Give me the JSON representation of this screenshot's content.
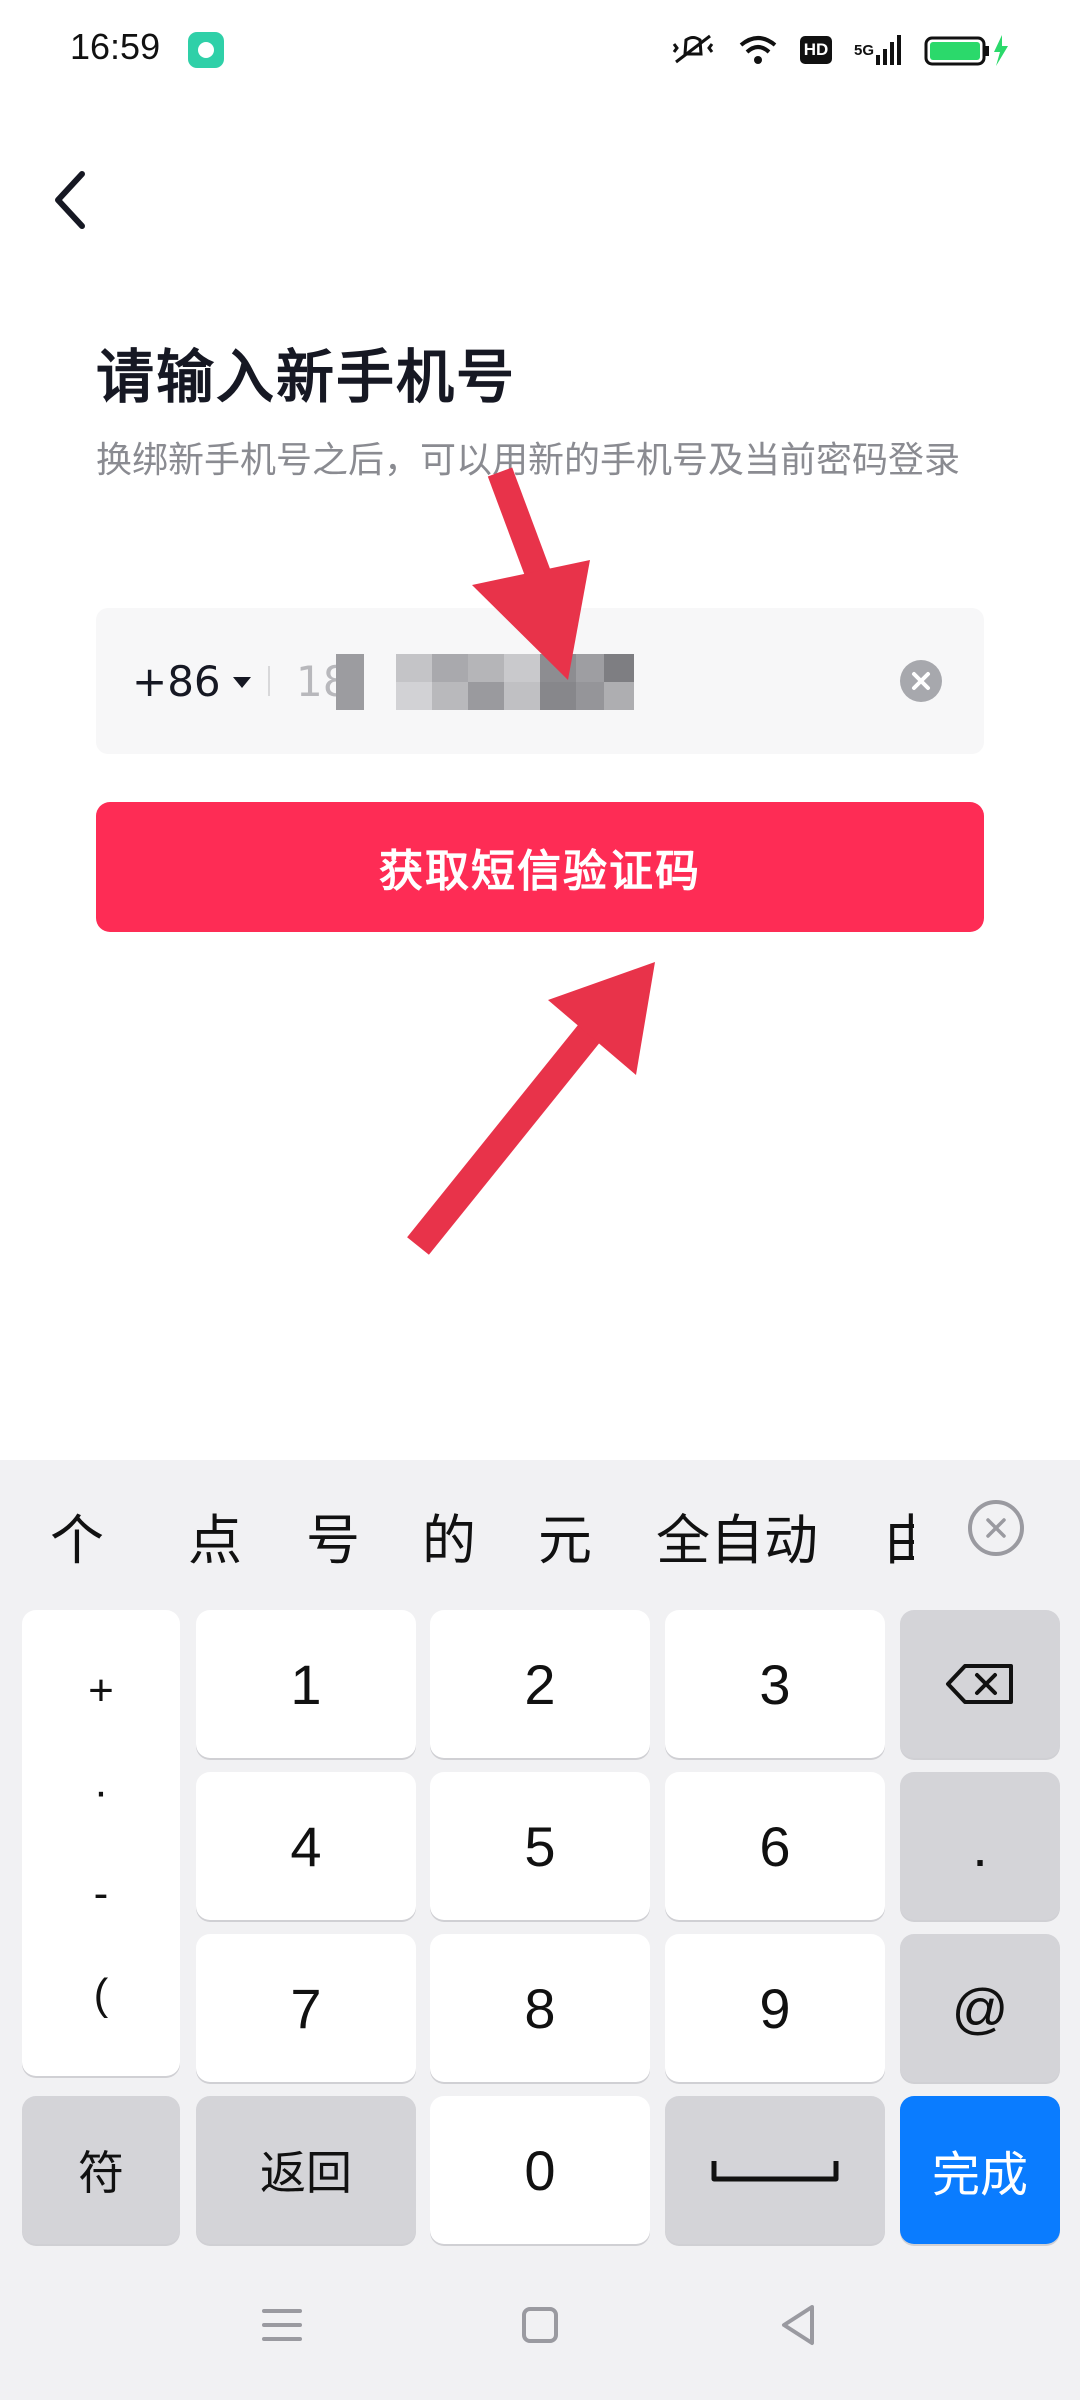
{
  "status_bar": {
    "time": "16:59",
    "icons": [
      "app-notification-icon",
      "mute-vibrate-icon",
      "wifi-icon",
      "hd-icon",
      "5g-signal-icon",
      "battery-charging-icon"
    ],
    "hd_label": "HD",
    "network_label": "5G",
    "battery_color": "#2bd96b"
  },
  "header": {
    "back_icon": "chevron-left-icon",
    "title": "请输入新手机号",
    "subtitle": "换绑新手机号之后，可以用新的手机号及当前密码登录"
  },
  "phone_input": {
    "country_code": "+86",
    "value_visible": "18",
    "clear_icon": "clear-circle-icon"
  },
  "submit_button": {
    "label": "获取短信验证码",
    "color": "#fe2c55"
  },
  "annotations": {
    "arrow_color": "#e8334a"
  },
  "keyboard": {
    "suggestions": [
      "个",
      "点",
      "号",
      "的",
      "元",
      "全自动",
      "由"
    ],
    "suggestion_close_icon": "close-circle-icon",
    "symbol_column": [
      "+",
      "·",
      "-",
      "("
    ],
    "digits": [
      "1",
      "2",
      "3",
      "4",
      "5",
      "6",
      "7",
      "8",
      "9",
      "0"
    ],
    "backspace_icon": "backspace-icon",
    "dot_key": ".",
    "at_key": "@",
    "symbols_key": "符",
    "back_key": "返回",
    "space_icon": "space-bar-icon",
    "done_key": "完成",
    "done_color": "#0a7cff"
  },
  "nav_bar": {
    "buttons": [
      "menu-icon",
      "home-square-icon",
      "back-triangle-icon"
    ]
  }
}
